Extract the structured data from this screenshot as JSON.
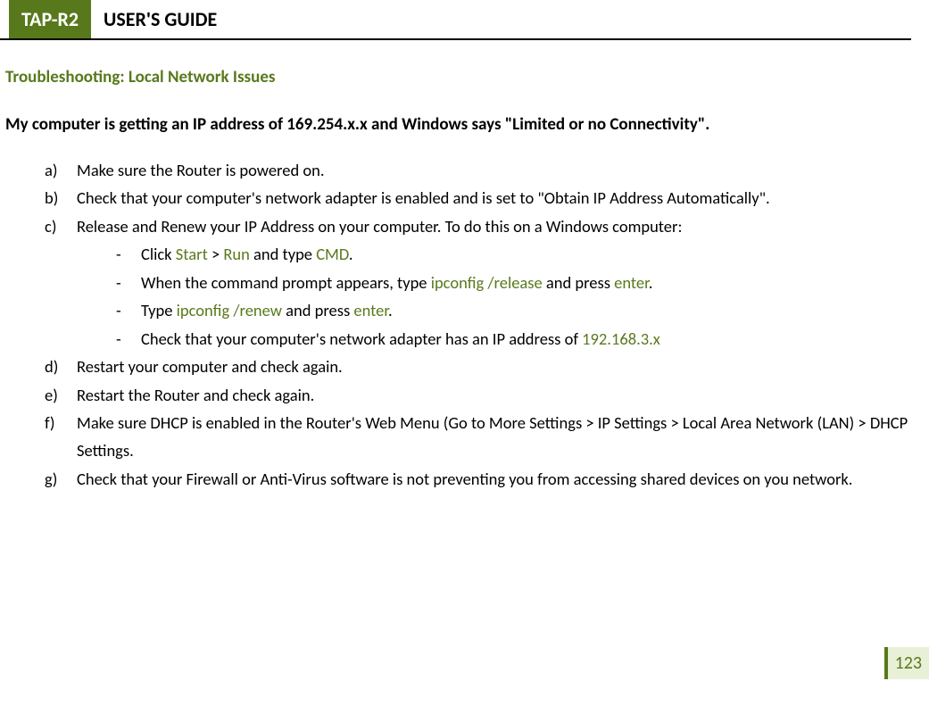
{
  "header": {
    "badge": "TAP-R2",
    "title": "USER'S GUIDE"
  },
  "section_title": "Troubleshooting: Local Network Issues",
  "question": "My computer is getting an IP address of 169.254.x.x and Windows says \"Limited or no Connectivity\".",
  "items": {
    "a": {
      "marker": "a)",
      "text": "Make sure the Router is powered on."
    },
    "b": {
      "marker": "b)",
      "text": "Check that your computer's network adapter is enabled and is set to \"Obtain IP Address Automatically\"."
    },
    "c": {
      "marker": "c)",
      "text": "Release and Renew your IP Address on your computer.  To do this on a Windows computer:",
      "sub": {
        "s1": {
          "pre1": "Click ",
          "kw1": "Start",
          "mid1": " > ",
          "kw2": "Run",
          "mid2": " and type ",
          "kw3": "CMD",
          "post": "."
        },
        "s2": {
          "pre1": "When the command prompt appears, type ",
          "kw1": "ipconfig /release",
          "mid1": " and press ",
          "kw2": "enter",
          "post": "."
        },
        "s3": {
          "pre1": "Type ",
          "kw1": "ipconfig /renew",
          "mid1": " and press ",
          "kw2": "enter",
          "post": "."
        },
        "s4": {
          "pre1": "Check that your computer's network adapter has an IP address of ",
          "kw1": "192.168.3.x"
        }
      }
    },
    "d": {
      "marker": "d)",
      "text": "Restart your computer and check again."
    },
    "e": {
      "marker": "e)",
      "text": "Restart the Router and check again."
    },
    "f": {
      "marker": "f)",
      "text": "Make sure DHCP is enabled in the Router's Web Menu (Go to More Settings > IP Settings > Local Area Network (LAN) > DHCP Settings."
    },
    "g": {
      "marker": "g)",
      "text": "Check that your Firewall or Anti-Virus software is not preventing you from accessing shared devices on you network."
    }
  },
  "dash": "-",
  "page_number": "123"
}
